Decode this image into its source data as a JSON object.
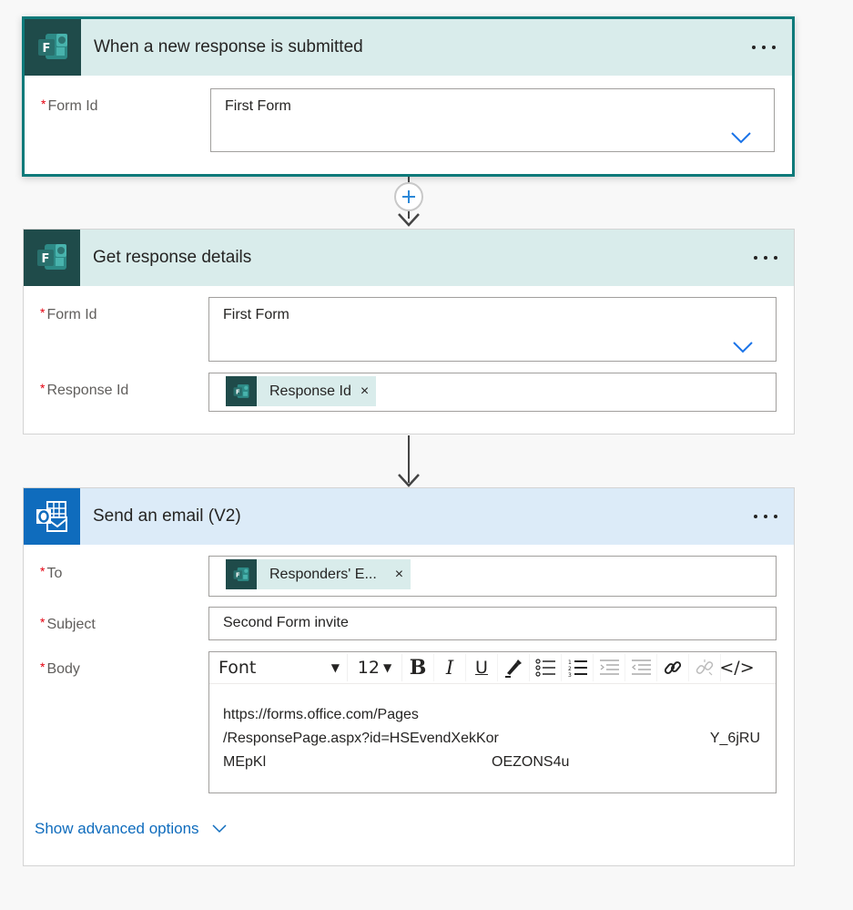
{
  "trigger": {
    "title": "When a new response is submitted",
    "icon": "microsoft-forms-icon",
    "fields": [
      {
        "label": "Form Id",
        "required": true,
        "value": "First Form",
        "type": "dropdown"
      }
    ]
  },
  "connector1": {
    "add_step_icon": "plus-icon",
    "arrow_icon": "arrow-down-icon"
  },
  "get_response": {
    "title": "Get response details",
    "icon": "microsoft-forms-icon",
    "fields": [
      {
        "label": "Form Id",
        "required": true,
        "value": "First Form",
        "type": "dropdown"
      },
      {
        "label": "Response Id",
        "required": true,
        "token": "Response Id",
        "type": "token"
      }
    ]
  },
  "connector2": {
    "arrow_icon": "arrow-down-icon"
  },
  "send_email": {
    "title": "Send an email (V2)",
    "icon": "outlook-icon",
    "fields": {
      "to": {
        "label": "To",
        "required": true,
        "token": "Responders' E..."
      },
      "subject": {
        "label": "Subject",
        "required": true,
        "value": "Second Form invite"
      },
      "body": {
        "label": "Body",
        "required": true,
        "toolbar": {
          "font": "Font",
          "size": "12",
          "buttons": [
            "bold",
            "italic",
            "underline",
            "highlight",
            "bullet-list",
            "numbered-list",
            "decrease-indent",
            "increase-indent",
            "link",
            "unlink",
            "code-view"
          ]
        },
        "lines": [
          {
            "left": "https://forms.office.com/Pages",
            "right": ""
          },
          {
            "left": "/ResponsePage.aspx?id=HSEvendXekKor",
            "right": "Y_6jRU"
          },
          {
            "left": "MEpKl",
            "right": "OEZONS4u"
          }
        ]
      }
    },
    "advanced_label": "Show advanced options"
  },
  "required_marker": "*",
  "token_close": "×"
}
